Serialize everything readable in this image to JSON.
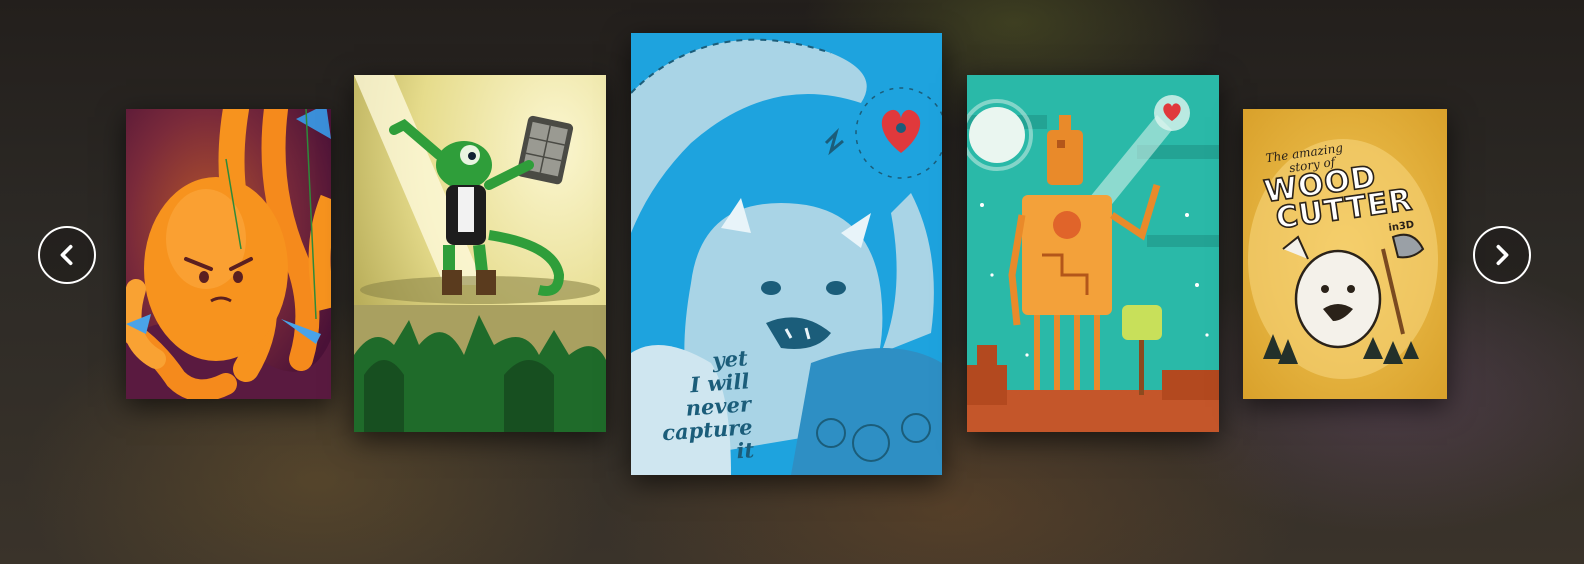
{
  "carousel": {
    "prev_icon": "chevron-left-icon",
    "next_icon": "chevron-right-icon",
    "cards": [
      {
        "id": "octopus",
        "icon": "octopus-illustration"
      },
      {
        "id": "chameleon",
        "icon": "chameleon-illustration"
      },
      {
        "id": "yeti",
        "icon": "yeti-illustration",
        "caption_lines": [
          "yet",
          "I will",
          "never",
          "capture it"
        ]
      },
      {
        "id": "robot",
        "icon": "robot-illustration"
      },
      {
        "id": "woodcutter",
        "icon": "woodcutter-illustration",
        "title_small_1": "The amazing",
        "title_small_2": "story of",
        "title_big_1": "WOOD",
        "title_big_2": "CUTTER",
        "title_suffix": "in3D"
      }
    ]
  },
  "colors": {
    "octopus_bg": "#6a1f45",
    "octopus_orange": "#f7931e",
    "chameleon_bg": "#e6dc8c",
    "chameleon_green": "#2f9e3a",
    "yeti_bg": "#1ea3de",
    "yeti_fur": "#a9d4e6",
    "robot_bg": "#2ab9a8",
    "robot_orange": "#e98a2a",
    "wood_bg": "#e9b73d"
  }
}
